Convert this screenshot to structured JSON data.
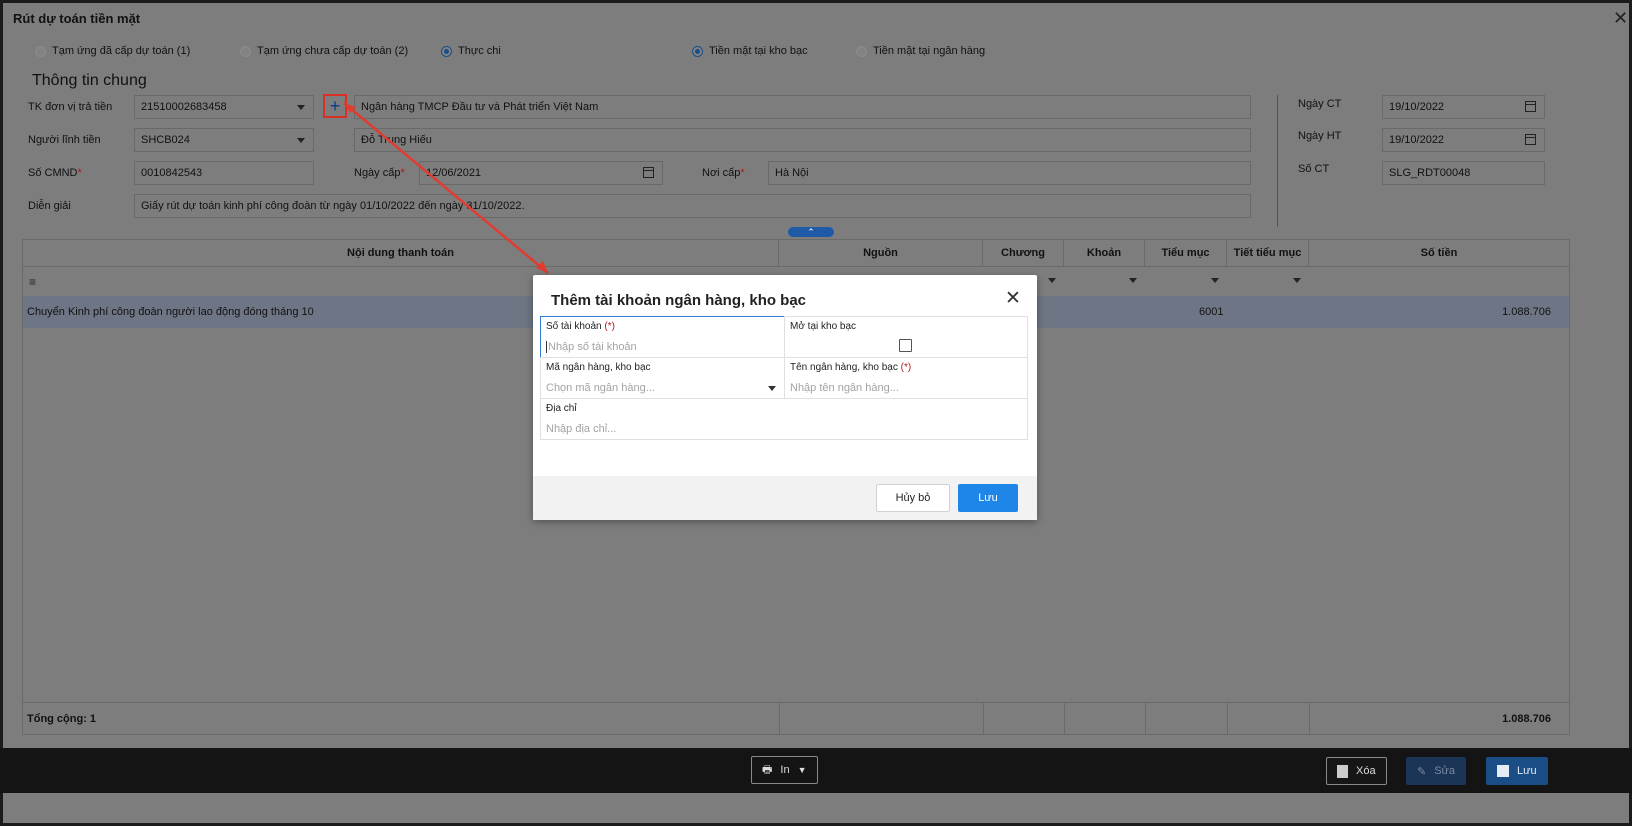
{
  "window": {
    "title": "Rút dự toán tiền mặt",
    "close_icon": "close-icon"
  },
  "radios_left": [
    {
      "label": "Tạm ứng đã cấp dự toán (1)",
      "selected": false
    },
    {
      "label": "Tạm ứng chưa cấp dự toán (2)",
      "selected": false
    },
    {
      "label": "Thực chi",
      "selected": true
    }
  ],
  "radios_right": [
    {
      "label": "Tiền mặt tại kho bạc",
      "selected": true
    },
    {
      "label": "Tiền mặt tại ngân hàng",
      "selected": false
    }
  ],
  "section_title": "Thông tin chung",
  "form": {
    "tk_label": "TK đơn vị trả tiền",
    "tk_value": "21510002683458",
    "bank_name": "Ngân hàng TMCP Đầu tư và Phát triển Việt Nam",
    "nguoi_label": "Người lĩnh tiền",
    "nguoi_value": "SHCB024",
    "nguoi_name": "Đỗ Trung Hiếu",
    "cmnd_label": "Số CMND",
    "cmnd_value": "0010842543",
    "ngaycap_label": "Ngày cấp",
    "ngaycap_value": "12/06/2021",
    "noicap_label": "Nơi cấp",
    "noicap_value": "Hà Nội",
    "diengiai_label": "Diễn giải",
    "diengiai_value": "Giấy rút dự toán kinh phí công đoàn từ ngày 01/10/2022 đến ngày 31/10/2022.",
    "required_mark": "*"
  },
  "right_form": {
    "ngayct_label": "Ngày CT",
    "ngayct_value": "19/10/2022",
    "ngayht_label": "Ngày HT",
    "ngayht_value": "19/10/2022",
    "soct_label": "Số CT",
    "soct_value": "SLG_RDT00048"
  },
  "grid": {
    "headers": [
      "Nội dung thanh toán",
      "Nguồn",
      "Chương",
      "Khoản",
      "Tiểu mục",
      "Tiết tiểu mục",
      "Số tiền"
    ],
    "row": {
      "content": "Chuyển Kinh phí công đoàn người lao động đóng tháng 10",
      "tieumuc": "6001",
      "sotien": "1.088.706"
    },
    "footer_label": "Tổng cộng: 1",
    "footer_total": "1.088.706"
  },
  "bottom_bar": {
    "print_label": "In",
    "delete_label": "Xóa",
    "edit_label": "Sửa",
    "save_label": "Lưu"
  },
  "modal": {
    "title": "Thêm tài khoản ngân hàng, kho bạc",
    "account_label": "Số tài khoản",
    "account_required": "(*)",
    "account_placeholder": "Nhập số tài khoản",
    "kho_bac_label": "Mở tại kho bạc",
    "kho_bac_checked": false,
    "bank_code_label": "Mã ngân hàng, kho bạc",
    "bank_code_placeholder": "Chọn mã ngân hàng...",
    "bank_name_label": "Tên ngân hàng, kho bạc",
    "bank_name_required": "(*)",
    "bank_name_placeholder": "Nhập tên ngân hàng...",
    "address_label": "Địa chỉ",
    "address_placeholder": "Nhập địa chỉ...",
    "cancel_label": "Hủy bỏ",
    "save_label": "Lưu"
  },
  "colors": {
    "accent": "#1f86e9",
    "highlight": "#d93025",
    "overlay": "#7d7d7d"
  }
}
